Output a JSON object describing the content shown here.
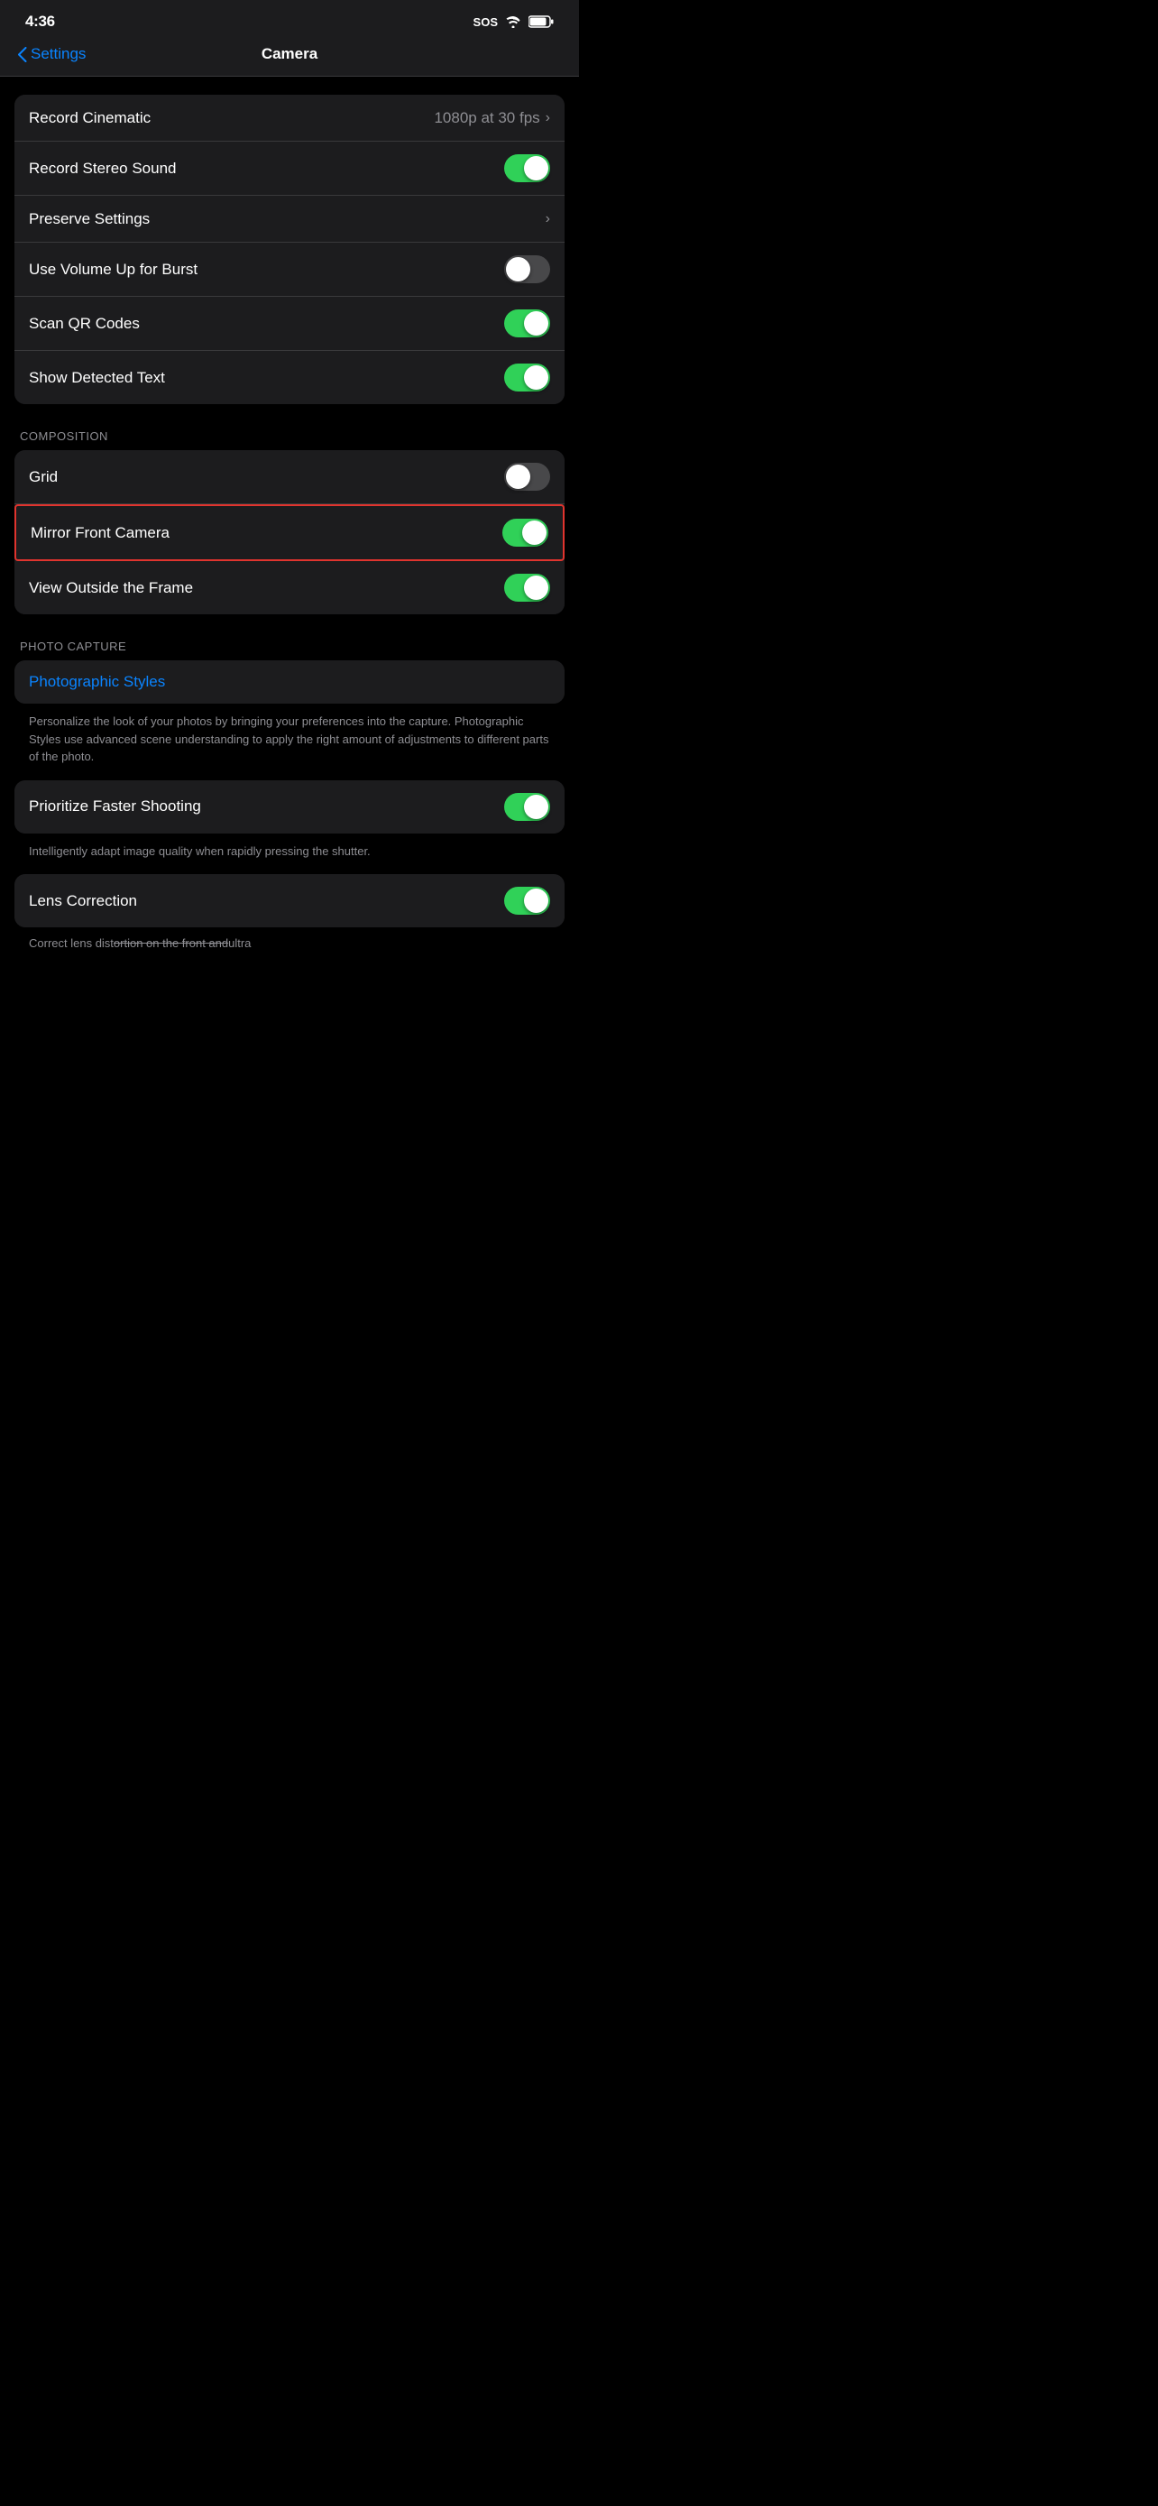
{
  "statusBar": {
    "time": "4:36",
    "sos": "SOS",
    "wifi": "wifi",
    "battery": "battery"
  },
  "nav": {
    "backLabel": "Settings",
    "title": "Camera"
  },
  "topSection": {
    "rows": [
      {
        "id": "record-cinematic",
        "label": "Record Cinematic",
        "type": "value-chevron",
        "value": "1080p at 30 fps"
      },
      {
        "id": "record-stereo-sound",
        "label": "Record Stereo Sound",
        "type": "toggle",
        "on": true
      },
      {
        "id": "preserve-settings",
        "label": "Preserve Settings",
        "type": "chevron"
      },
      {
        "id": "use-volume-up-for-burst",
        "label": "Use Volume Up for Burst",
        "type": "toggle",
        "on": false
      },
      {
        "id": "scan-qr-codes",
        "label": "Scan QR Codes",
        "type": "toggle",
        "on": true
      },
      {
        "id": "show-detected-text",
        "label": "Show Detected Text",
        "type": "toggle",
        "on": true
      }
    ]
  },
  "composition": {
    "sectionLabel": "COMPOSITION",
    "rows": [
      {
        "id": "grid",
        "label": "Grid",
        "type": "toggle",
        "on": false,
        "highlighted": false
      },
      {
        "id": "mirror-front-camera",
        "label": "Mirror Front Camera",
        "type": "toggle",
        "on": true,
        "highlighted": true
      },
      {
        "id": "view-outside-the-frame",
        "label": "View Outside the Frame",
        "type": "toggle",
        "on": true,
        "highlighted": false
      }
    ]
  },
  "photoCapture": {
    "sectionLabel": "PHOTO CAPTURE",
    "photographicStyles": {
      "label": "Photographic Styles",
      "description": "Personalize the look of your photos by bringing your preferences into the capture. Photographic Styles use advanced scene understanding to apply the right amount of adjustments to different parts of the photo."
    },
    "prioritizeFasterShooting": {
      "label": "Prioritize Faster Shooting",
      "on": true,
      "description": "Intelligently adapt image quality when rapidly pressing the shutter."
    },
    "lensCorrection": {
      "label": "Lens Correction",
      "on": true,
      "descriptionPrefix": "Correct lens dist",
      "descriptionStrike": "ortion on the front and",
      "descriptionSuffix": "ultra"
    }
  }
}
